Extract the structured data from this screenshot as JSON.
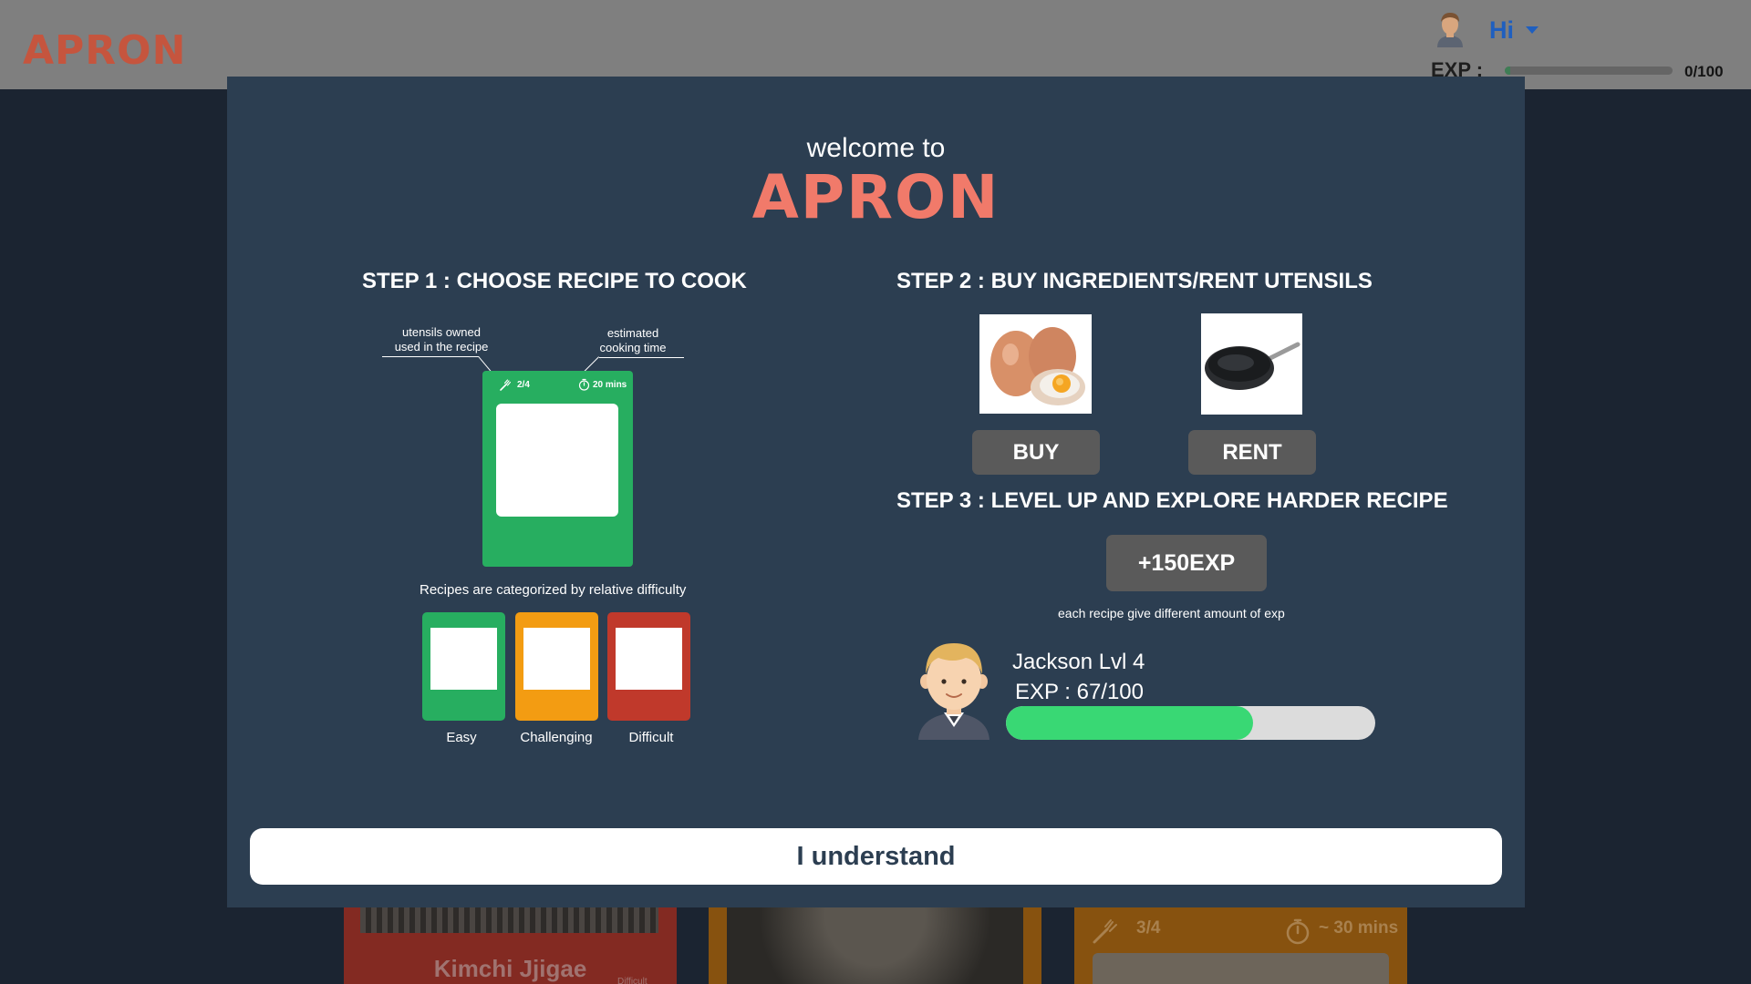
{
  "header": {
    "logo": "APRON",
    "greeting": "Hi",
    "exp_label": "EXP :",
    "exp_value": "0/100",
    "exp_progress": 0.03
  },
  "background_cards": [
    {
      "title": "Kimchi Jjigae",
      "badge": "Difficult"
    },
    {
      "title": ""
    },
    {
      "utensils": "3/4",
      "time": "~ 30 mins"
    }
  ],
  "modal": {
    "welcome": "welcome to",
    "logo": "APRON",
    "step1": {
      "title": "STEP 1 : CHOOSE RECIPE TO COOK",
      "annotation_utensils": [
        "utensils owned",
        "used in the recipe"
      ],
      "annotation_time": [
        "estimated",
        "cooking time"
      ],
      "card_utensils": "2/4",
      "card_time": "20 mins",
      "categorized_text": "Recipes are categorized by relative difficulty",
      "difficulties": [
        {
          "label": "Easy",
          "color": "#27ae60"
        },
        {
          "label": "Challenging",
          "color": "#f39c12"
        },
        {
          "label": "Difficult",
          "color": "#c0392b"
        }
      ]
    },
    "step2": {
      "title": "STEP 2 : BUY INGREDIENTS/RENT UTENSILS",
      "buy_label": "BUY",
      "rent_label": "RENT"
    },
    "step3": {
      "title": "STEP 3 : LEVEL UP AND EXPLORE HARDER RECIPE",
      "exp_button": "+150EXP",
      "exp_note": "each recipe give different amount of exp",
      "player_name": "Jackson  Lvl 4",
      "player_exp": "EXP : 67/100",
      "player_progress": 0.67
    },
    "confirm_label": "I understand"
  }
}
